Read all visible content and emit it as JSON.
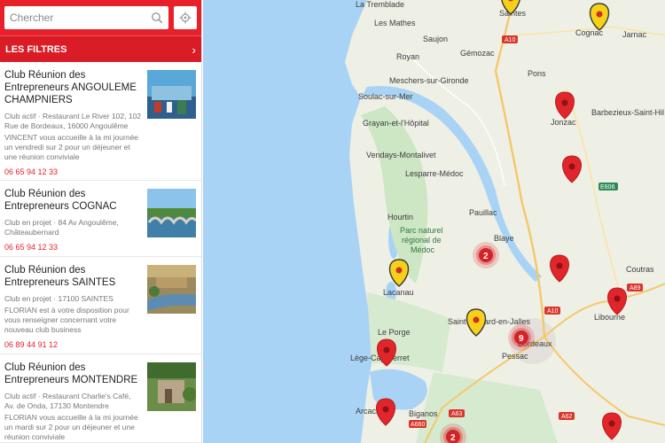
{
  "search": {
    "placeholder": "Chercher"
  },
  "filters": {
    "label": "LES FILTRES"
  },
  "clubs": [
    {
      "name": "Club Réunion des Entrepreneurs ANGOULEME CHAMPNIERS",
      "address": "Club actif · Restaurant Le River 102, 102 Rue de Bordeaux, 16000 Angoulême",
      "description": "VINCENT vous accueille à la mi journée un vendredi sur 2 pour un déjeuner et une réunion conviviale",
      "phone": "06 65 94 12 33"
    },
    {
      "name": "Club Réunion des Entrepreneurs COGNAC",
      "address": "Club en projet · 84 Av Angoulême, Châteaubernard",
      "description": "",
      "phone": "06 65 94 12 33"
    },
    {
      "name": "Club Réunion des Entrepreneurs SAINTES",
      "address": "Club en projet · 17100 SAINTES",
      "description": "FLORIAN est à votre disposition pour vous renseigner concernant votre nouveau club business",
      "phone": "06 89 44 91 12"
    },
    {
      "name": "Club Réunion des Entrepreneurs MONTENDRE",
      "address": "Club actif · Restaurant Charlie's Café, Av. de Onda, 17130 Montendre",
      "description": "FLORIAN vous accueille à la mi journée un mardi sur 2 pour un déjeuner et une réunion conviviale",
      "phone": ""
    }
  ],
  "map": {
    "places": {
      "la_tremblade": "La Tremblade",
      "saintes": "Saintes",
      "les_mathes": "Les Mathes",
      "cognac": "Cognac",
      "jarnac": "Jarnac",
      "saujon": "Saujon",
      "royan": "Royan",
      "gemozac": "Gémozac",
      "meschers": "Meschers-sur-Gironde",
      "pons": "Pons",
      "soulac": "Soulac-sur-Mer",
      "grayan": "Grayan-et-l'Hôpital",
      "jonzac": "Jonzac",
      "barbezieux": "Barbezieux-Saint-Hil",
      "vendays": "Vendays-Montalivet",
      "lesparre": "Lesparre-Médoc",
      "hourtin": "Hourtin",
      "pauillac": "Pauillac",
      "park1": "Parc naturel",
      "park2": "régional de",
      "park3": "Médoc",
      "blaye": "Blaye",
      "coutras": "Coutras",
      "lacanau": "Lacanau",
      "saint_medard": "Saint-Médard-en-Jalles",
      "libourne": "Libourne",
      "le_porge": "Le Porge",
      "lege": "Lège-Cap-Ferret",
      "bordeaux": "Bordeaux",
      "pessac": "Pessac",
      "arcachon": "Arcachon",
      "biganos": "Biganos"
    },
    "roads": {
      "a10": "A10",
      "a10b": "A10",
      "e606": "E606",
      "a89": "A89",
      "a63": "A63",
      "a62": "A62",
      "a660": "A660"
    },
    "clusters": {
      "c1": "2",
      "c2": "9",
      "c3": "2"
    },
    "colors": {
      "water": "#a9d3f5",
      "land": "#eef0e6",
      "park": "#cde6c4",
      "pin_red": "#e0262a",
      "pin_yellow": "#f7d117",
      "accent": "#e8202a"
    }
  }
}
